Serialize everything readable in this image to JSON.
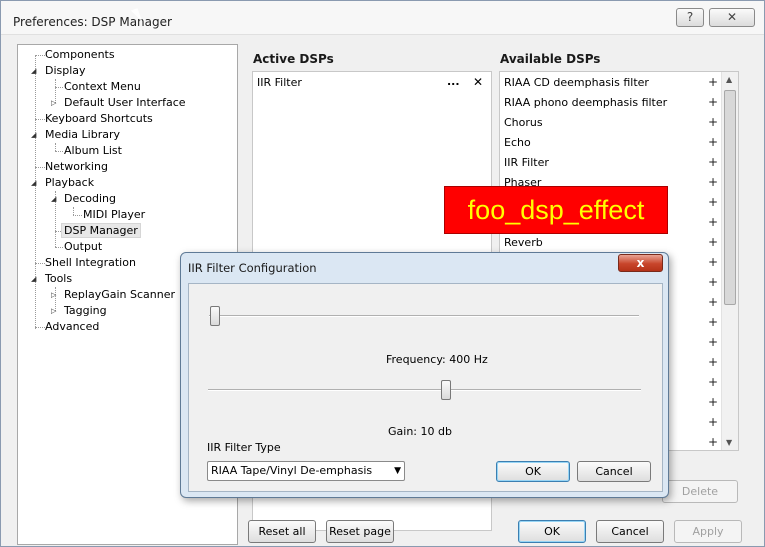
{
  "window": {
    "title": "Preferences: DSP Manager",
    "help_label": "?",
    "close_label": "✕"
  },
  "tree": {
    "items": [
      {
        "label": "Components"
      },
      {
        "label": "Display"
      },
      {
        "label": "Context Menu"
      },
      {
        "label": "Default User Interface"
      },
      {
        "label": "Keyboard Shortcuts"
      },
      {
        "label": "Media Library"
      },
      {
        "label": "Album List"
      },
      {
        "label": "Networking"
      },
      {
        "label": "Playback"
      },
      {
        "label": "Decoding"
      },
      {
        "label": "MIDI Player"
      },
      {
        "label": "DSP Manager"
      },
      {
        "label": "Output"
      },
      {
        "label": "Shell Integration"
      },
      {
        "label": "Tools"
      },
      {
        "label": "ReplayGain Scanner"
      },
      {
        "label": "Tagging"
      },
      {
        "label": "Advanced"
      }
    ],
    "expanded_glyph": "◢",
    "collapsed_glyph": "▷"
  },
  "active": {
    "header": "Active DSPs",
    "items": [
      {
        "label": "IIR Filter",
        "more": "...",
        "remove": "✕"
      }
    ]
  },
  "available": {
    "header": "Available DSPs",
    "add_glyph": "+",
    "items": [
      "RIAA CD deemphasis filter",
      "RIAA phono deemphasis filter",
      "Chorus",
      "Echo",
      "IIR Filter",
      "Phaser",
      "Reverb"
    ]
  },
  "overlay_label": "foo_dsp_effect",
  "buttons": {
    "delete": "Delete",
    "reset_all": "Reset all",
    "reset_page": "Reset page",
    "ok": "OK",
    "cancel": "Cancel",
    "apply": "Apply"
  },
  "dialog": {
    "title": "IIR Filter Configuration",
    "close_label": "x",
    "frequency_label": "Frequency: 400 Hz",
    "gain_label": "Gain: 10 db",
    "filter_type_label": "IIR Filter Type",
    "filter_type_value": "RIAA Tape/Vinyl De-emphasis",
    "ok": "OK",
    "cancel": "Cancel"
  }
}
